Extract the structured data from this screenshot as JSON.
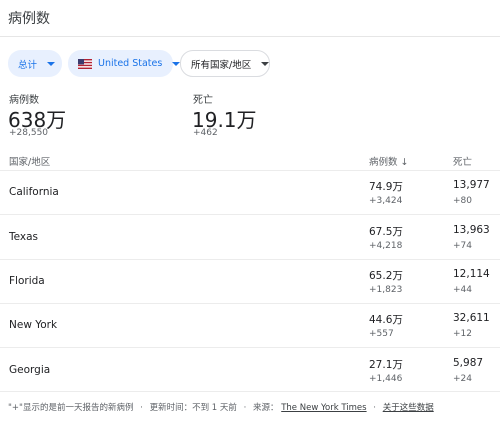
{
  "title": "病例数",
  "filters": {
    "total": "总计",
    "country": "United States",
    "region": "所有国家/地区"
  },
  "summary": {
    "cases_label": "病例数",
    "cases_value": "638万",
    "cases_delta": "+28,550",
    "deaths_label": "死亡",
    "deaths_value": "19.1万",
    "deaths_delta": "+462"
  },
  "table": {
    "headers": {
      "region": "国家/地区",
      "cases": "病例数",
      "cases_sort": "↓",
      "deaths": "死亡"
    },
    "rows": [
      {
        "name": "California",
        "cases": "74.9万",
        "cases_delta": "+3,424",
        "deaths": "13,977",
        "deaths_delta": "+80"
      },
      {
        "name": "Texas",
        "cases": "67.5万",
        "cases_delta": "+4,218",
        "deaths": "13,963",
        "deaths_delta": "+74"
      },
      {
        "name": "Florida",
        "cases": "65.2万",
        "cases_delta": "+1,823",
        "deaths": "12,114",
        "deaths_delta": "+44"
      },
      {
        "name": "New York",
        "cases": "44.6万",
        "cases_delta": "+557",
        "deaths": "32,611",
        "deaths_delta": "+12"
      },
      {
        "name": "Georgia",
        "cases": "27.1万",
        "cases_delta": "+1,446",
        "deaths": "5,987",
        "deaths_delta": "+24"
      }
    ]
  },
  "footer": {
    "note": "\"+\"显示的是前一天报告的新病例",
    "sep": "·",
    "updated": "更新时间：不到 1 天前",
    "source_label": "来源：",
    "source_link": "The New York Times",
    "about_link": "关于这些数据"
  },
  "colors": {
    "accent": "#1a73e8",
    "chip_bg": "#e8f0fe"
  }
}
